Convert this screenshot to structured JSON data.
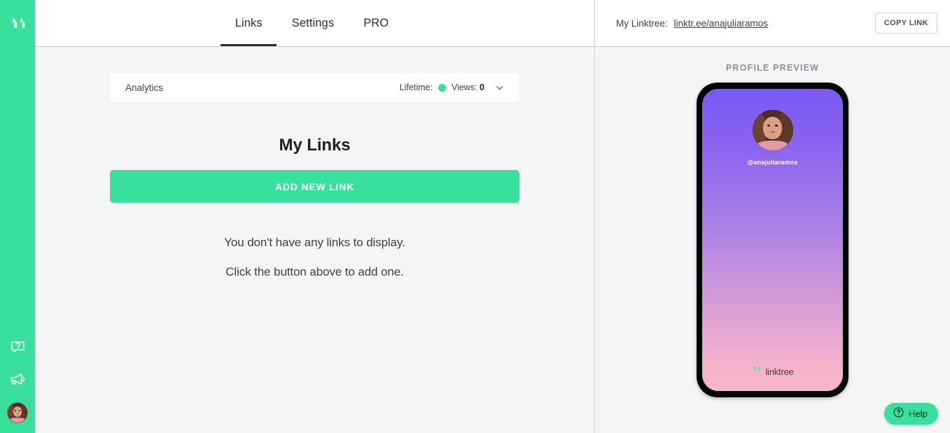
{
  "sidebar": {
    "logo_icon": "linktree-logo-icon",
    "help_icon": "question-speech-bubble-icon",
    "announcements_icon": "megaphone-icon",
    "avatar_alt": "user-avatar"
  },
  "left_header": {
    "tabs": [
      {
        "label": "Links",
        "active": true
      },
      {
        "label": "Settings",
        "active": false
      },
      {
        "label": "PRO",
        "active": false
      }
    ]
  },
  "analytics": {
    "title": "Analytics",
    "period_label": "Lifetime:",
    "status_dot_color": "#39e09b",
    "views_label": "Views:",
    "views_value": "0",
    "chevron_icon": "chevron-down-icon"
  },
  "main": {
    "heading": "My Links",
    "add_link_label": "ADD NEW LINK",
    "empty_line_1": "You don't have any links to display.",
    "empty_line_2": "Click the button above to add one."
  },
  "right_header": {
    "my_linktree_label": "My Linktree:",
    "url": "linktr.ee/anajuliaramos",
    "copy_link_label": "COPY LINK"
  },
  "preview": {
    "title": "PROFILE PREVIEW",
    "handle": "@anajuliaramos",
    "footer_brand": "linktree",
    "footer_logo_icon": "linktree-logo-icon",
    "gradient_top": "#7a5af5",
    "gradient_mid": "#ab80e5",
    "gradient_bottom": "#f7b6cb"
  },
  "help_widget": {
    "label": "Help",
    "icon": "question-circle-icon",
    "background": "#39e09b"
  },
  "theme": {
    "brand_green": "#39e09b",
    "page_background": "#f4f5f7",
    "header_background": "#ffffff",
    "text_primary": "#1d1f23"
  }
}
